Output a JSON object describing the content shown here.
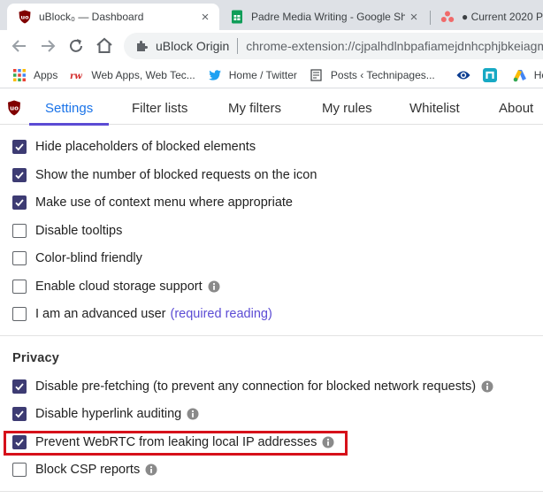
{
  "browser": {
    "tabs": [
      {
        "title": "uBlock₀ — Dashboard",
        "close": "×"
      },
      {
        "title": "Padre Media Writing - Google Sh",
        "close": "×"
      },
      {
        "title": "● Current 2020 Pr"
      }
    ],
    "omnibox": {
      "site_name": "uBlock Origin",
      "url": "chrome-extension://cjpalhdlnbpafiamejdnhcphjbkeiagm"
    },
    "bookmarks": [
      {
        "label": "Apps",
        "icon": "apps-grid-icon"
      },
      {
        "label": "Web Apps, Web Tec...",
        "icon": "rw-icon"
      },
      {
        "label": "Home / Twitter",
        "icon": "twitter-icon"
      },
      {
        "label": "Posts ‹ Technipages...",
        "icon": "posts-icon"
      },
      {
        "label": "",
        "icon": "cbs-eye-icon"
      },
      {
        "label": "",
        "icon": "n-icon"
      },
      {
        "label": "Ho",
        "icon": "google-ads-icon"
      }
    ]
  },
  "ublock": {
    "nav": [
      "Settings",
      "Filter lists",
      "My filters",
      "My rules",
      "Whitelist",
      "About"
    ],
    "active_tab": "Settings",
    "appearance_options": [
      {
        "label": "Hide placeholders of blocked elements",
        "checked": true
      },
      {
        "label": "Show the number of blocked requests on the icon",
        "checked": true
      },
      {
        "label": "Make use of context menu where appropriate",
        "checked": true
      },
      {
        "label": "Disable tooltips",
        "checked": false
      },
      {
        "label": "Color-blind friendly",
        "checked": false
      },
      {
        "label": "Enable cloud storage support",
        "checked": false,
        "info": true
      },
      {
        "label": "I am an advanced user",
        "link": "(required reading)",
        "checked": false
      }
    ],
    "privacy_title": "Privacy",
    "privacy_options": [
      {
        "label": "Disable pre-fetching (to prevent any connection for blocked network requests)",
        "checked": true,
        "info": true
      },
      {
        "label": "Disable hyperlink auditing",
        "checked": true,
        "info": true
      },
      {
        "label": "Prevent WebRTC from leaking local IP addresses",
        "checked": true,
        "info": true,
        "highlighted": true
      },
      {
        "label": "Block CSP reports",
        "checked": false,
        "info": true
      }
    ]
  },
  "colors": {
    "accent": "#5b4bd4",
    "checkbox": "#3d3b73",
    "highlight": "#d6101a",
    "ublock_red": "#800000"
  }
}
